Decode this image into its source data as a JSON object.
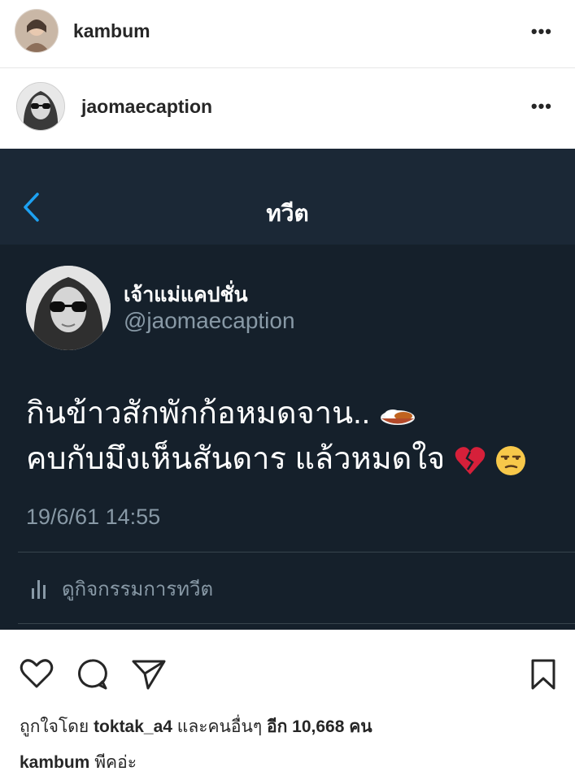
{
  "post": {
    "owner": {
      "username": "kambum",
      "more_label": "•••"
    },
    "media_author": {
      "username": "jaomaecaption",
      "more_label": "•••"
    },
    "tweet_screen": {
      "nav_title": "ทวีต",
      "display_name": "เจ้าแม่แคปชั่น",
      "handle": "@jaomaecaption",
      "text_line_1": "กินข้าวสักพักก้อหมดจาน..",
      "text_line_2": "คบกับมึงเห็นสันดาร แล้วหมดใจ",
      "timestamp": "19/6/61 14:55",
      "activity_label": "ดูกิจกรรมการทวีต"
    },
    "likes": {
      "prefix": "ถูกใจโดย",
      "user": "toktak_a4",
      "middle": "และคนอื่นๆ",
      "rest": "อีก 10,668 คน"
    },
    "caption": {
      "username": "kambum",
      "text": "พีคอ่ะ"
    }
  }
}
